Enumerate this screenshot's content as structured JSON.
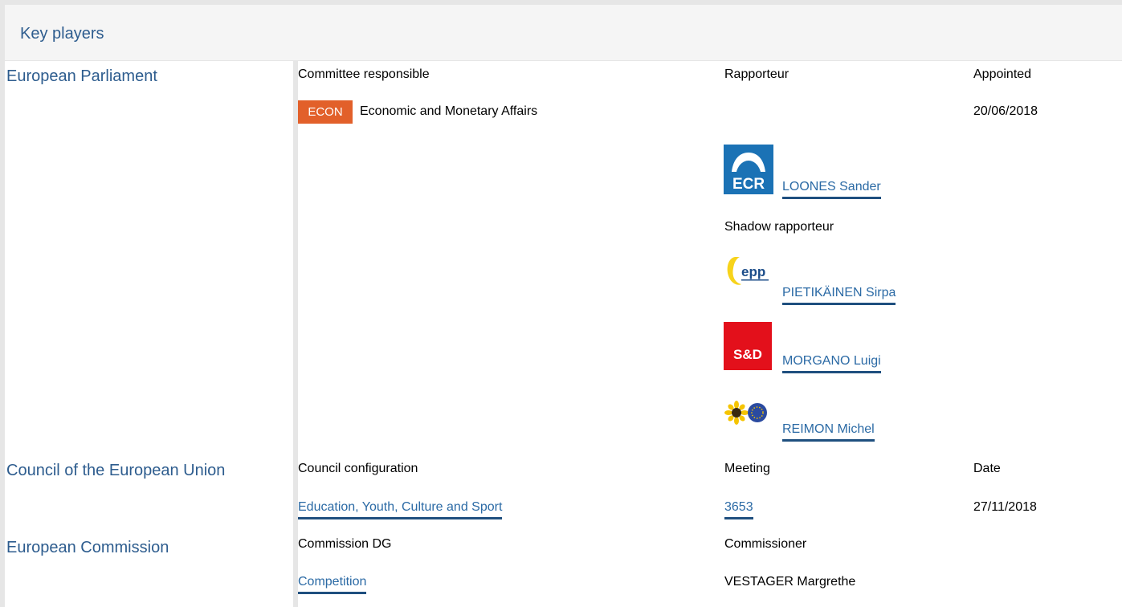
{
  "section_title": "Key players",
  "parliament": {
    "name": "European Parliament",
    "headers": {
      "committee": "Committee responsible",
      "rapporteur": "Rapporteur",
      "appointed": "Appointed"
    },
    "committee": {
      "code": "ECON",
      "name": "Economic and Monetary Affairs",
      "appointed": "20/06/2018"
    },
    "rapporteur": {
      "group_logo": "ECR",
      "name": "LOONES Sander"
    },
    "shadow_label": "Shadow rapporteur",
    "shadows": [
      {
        "group_logo": "epp",
        "name": "PIETIKÄINEN Sirpa"
      },
      {
        "group_logo": "S&D",
        "name": "MORGANO Luigi"
      },
      {
        "group_logo": "greens-efa-logo",
        "name": "REIMON Michel"
      }
    ]
  },
  "council": {
    "name": "Council of the European Union",
    "headers": {
      "configuration": "Council configuration",
      "meeting": "Meeting",
      "date": "Date"
    },
    "configuration": "Education, Youth, Culture and Sport",
    "meeting": "3653",
    "date": "27/11/2018"
  },
  "commission": {
    "name": "European Commission",
    "headers": {
      "dg": "Commission DG",
      "commissioner": "Commissioner"
    },
    "dg": "Competition",
    "commissioner": "VESTAGER Margrethe"
  },
  "colors": {
    "accent": "#2d5c8e",
    "badge": "#e2602a",
    "ecr": "#1b72b5",
    "sd": "#e3101b"
  }
}
